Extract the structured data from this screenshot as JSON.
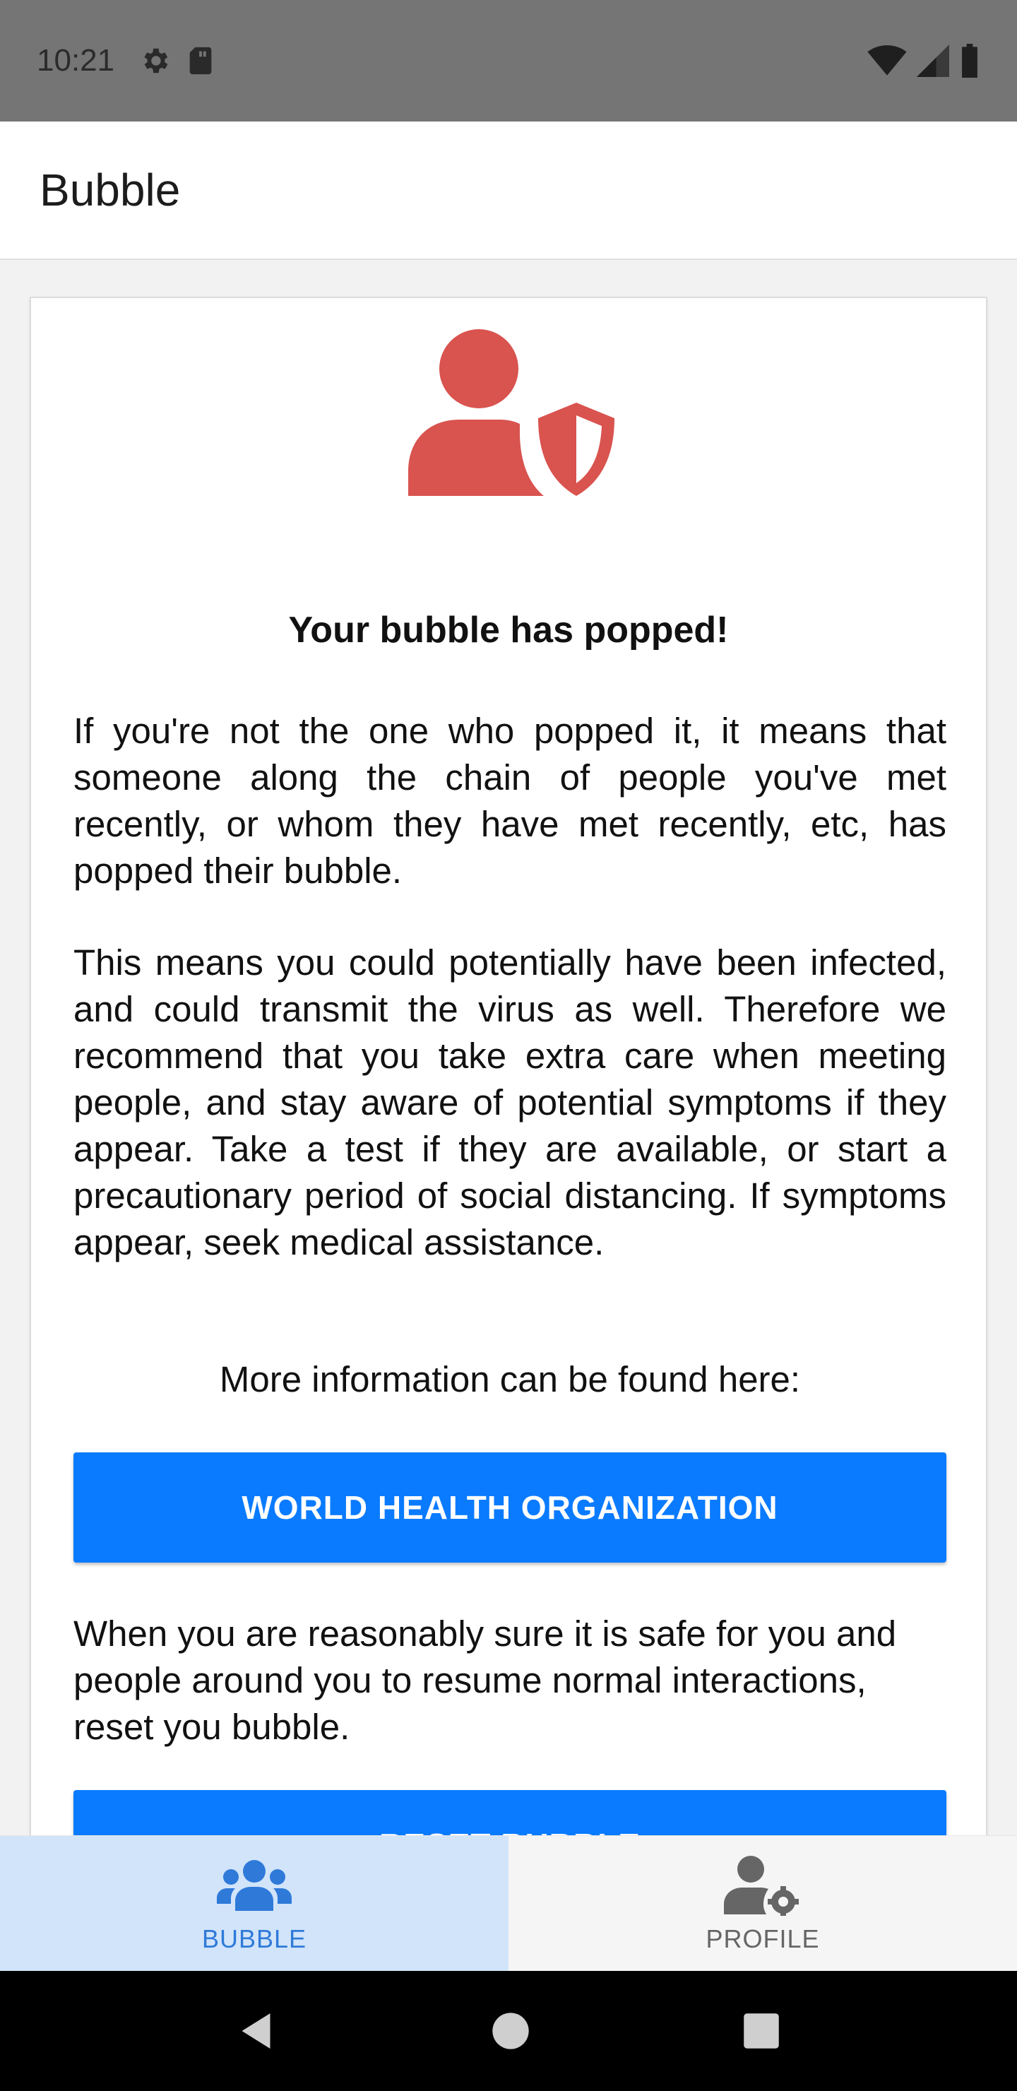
{
  "status_bar": {
    "time": "10:21",
    "icons": [
      "settings-icon",
      "sd-card-icon",
      "wifi-icon",
      "signal-icon",
      "battery-icon"
    ]
  },
  "app_bar": {
    "title": "Bubble"
  },
  "card": {
    "icon": "user-shield-icon",
    "icon_color": "#d9534f",
    "headline": "Your bubble has popped!",
    "paragraph_1": "If you're not the one who popped it, it means that someone along the chain of people you've met recently, or whom they have met recently, etc, has popped their bubble.",
    "paragraph_2": "This means you could potentially have been infected, and could transmit the virus as well. Therefore we recommend that you take extra care when meeting people, and stay aware of potential symptoms if they appear. Take a test if they are available, or start a precautionary period of social distancing. If symptoms appear, seek medical assistance.",
    "more_info": "More information can be found here:",
    "who_button": "WORLD HEALTH ORGANIZATION",
    "paragraph_3": "When you are reasonably sure it is safe for you and people around you to resume normal interactions, reset you bubble.",
    "reset_button": "RESET BUBBLE"
  },
  "bottom_nav": {
    "items": [
      {
        "label": "BUBBLE",
        "icon": "users-icon",
        "active": true
      },
      {
        "label": "PROFILE",
        "icon": "user-gear-icon",
        "active": false
      }
    ]
  },
  "colors": {
    "accent": "#0a7bff",
    "danger": "#d9534f",
    "nav_active_bg": "#d1e4fa",
    "nav_active_fg": "#2f7ad9"
  }
}
